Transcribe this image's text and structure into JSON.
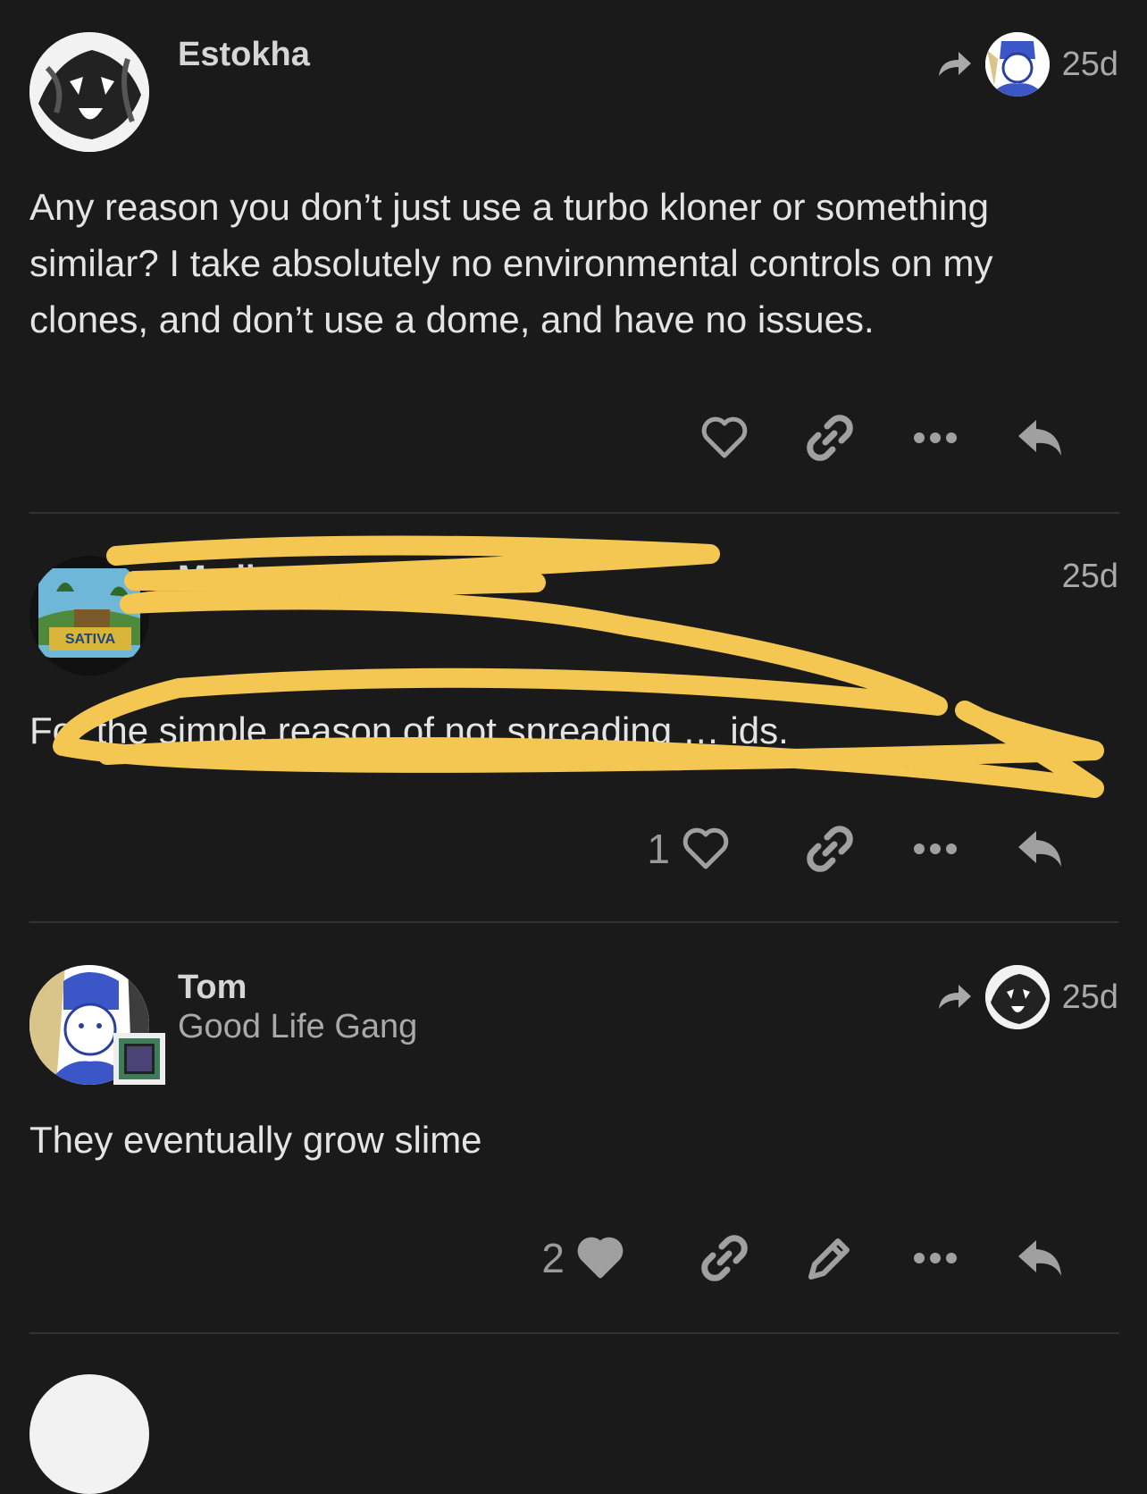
{
  "posts": [
    {
      "username": "Estokha",
      "date": "25d",
      "body": "Any reason you don’t just use a turbo kloner or something similar? I take absolutely no environmental controls on my clones, and don’t use a dome, and have no issues."
    },
    {
      "username": "Medic",
      "date": "25d",
      "body": "For the simple reason of not spreading … ids.",
      "like_count": "1"
    },
    {
      "username": "Tom",
      "usertitle": "Good Life Gang",
      "date": "25d",
      "body": "They eventually grow slime",
      "like_count": "2"
    }
  ],
  "colors": {
    "background": "#1a1a1a",
    "scribble": "#f4c753"
  },
  "icons": [
    "share-arrow-icon",
    "heart-icon",
    "link-icon",
    "more-icon",
    "reply-icon",
    "edit-icon"
  ]
}
